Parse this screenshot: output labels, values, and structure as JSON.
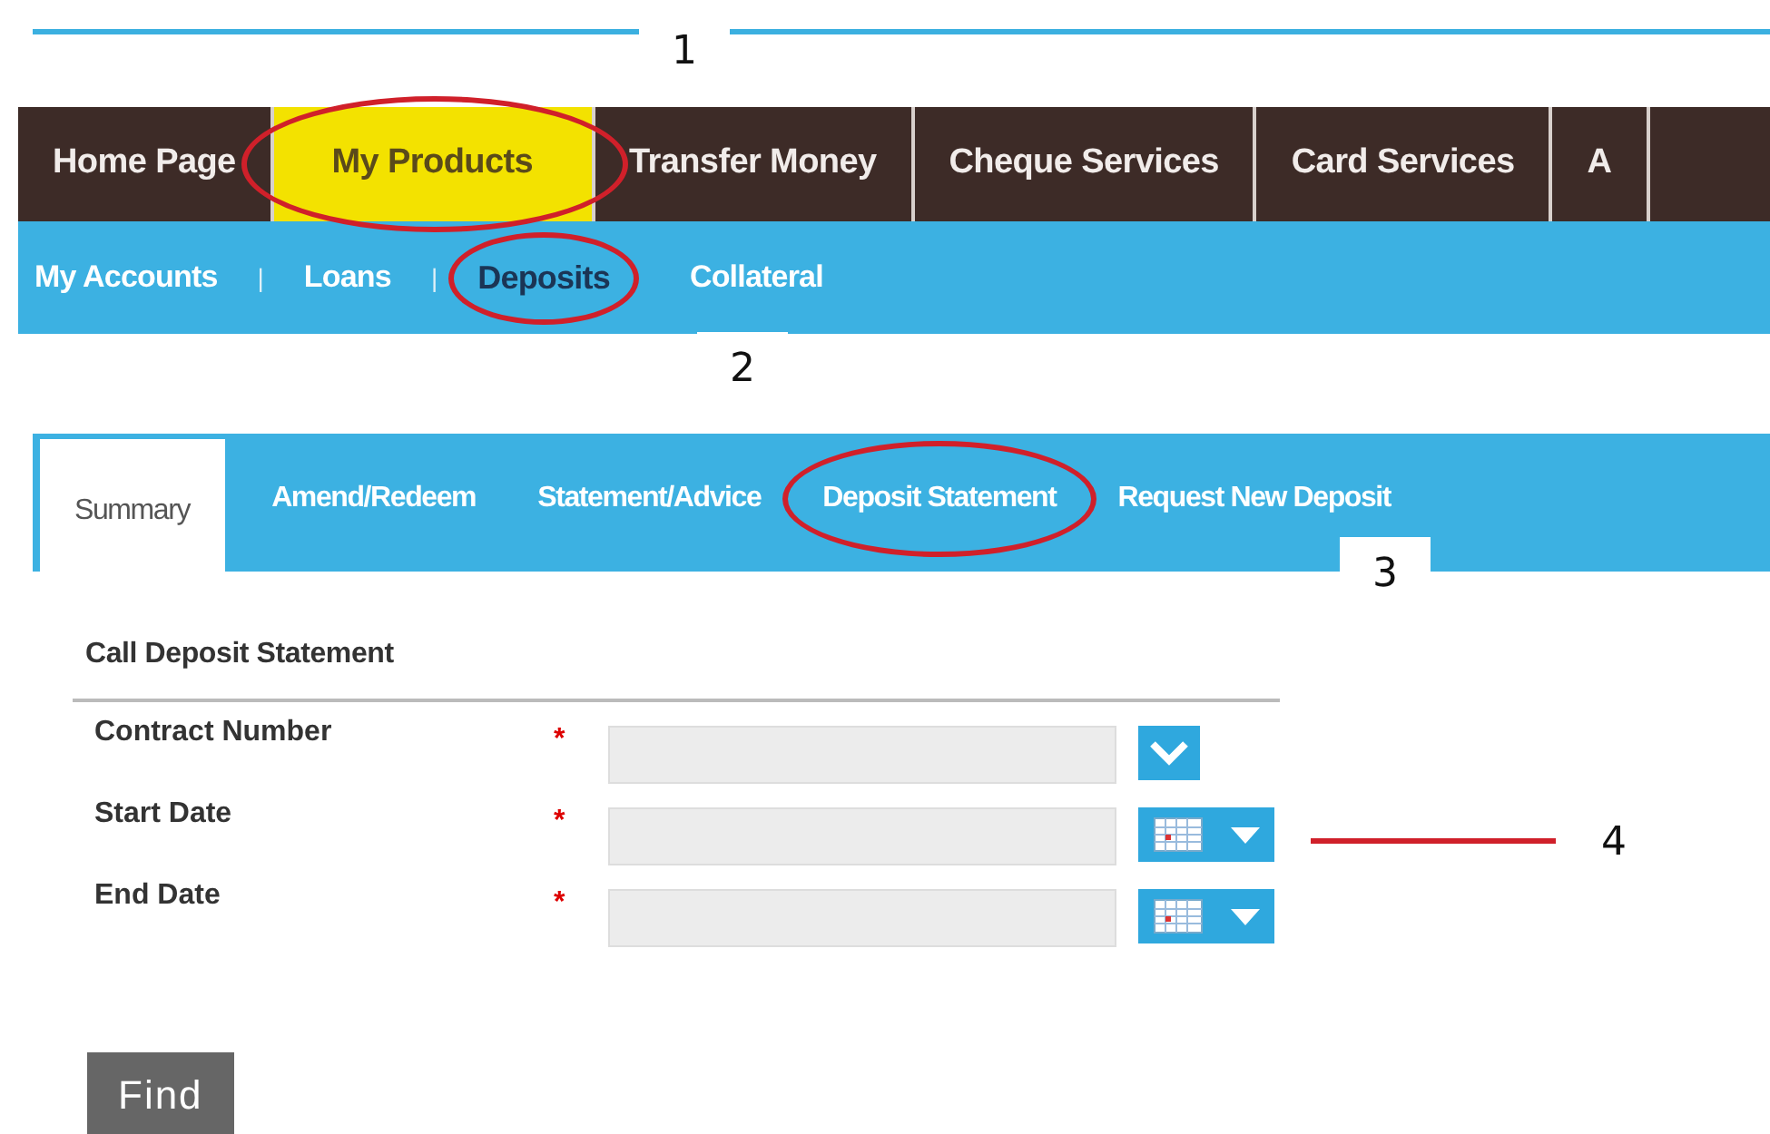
{
  "main_menu": [
    {
      "label": "Home Page",
      "selected": false,
      "circled": false
    },
    {
      "label": "My Products",
      "selected": true,
      "circled": true
    },
    {
      "label": "Transfer Money",
      "selected": false,
      "circled": false
    },
    {
      "label": "Cheque Services",
      "selected": false,
      "circled": false
    },
    {
      "label": "Card Services",
      "selected": false,
      "circled": false
    },
    {
      "label": "A",
      "selected": false,
      "circled": false
    }
  ],
  "sub_menu": [
    {
      "kind": "link",
      "label": "My Accounts",
      "selected": false,
      "circled": false
    },
    {
      "kind": "separator",
      "label": "|"
    },
    {
      "kind": "link",
      "label": "Loans",
      "selected": false,
      "circled": false
    },
    {
      "kind": "separator",
      "label": "|"
    },
    {
      "kind": "link",
      "label": "Deposits",
      "selected": true,
      "circled": true
    },
    {
      "kind": "link",
      "label": "Collateral",
      "selected": false,
      "circled": false
    }
  ],
  "tabs": [
    {
      "label": "Summary",
      "selected": true,
      "circled": false
    },
    {
      "label": "Amend/Redeem",
      "selected": false,
      "circled": false
    },
    {
      "label": "Statement/Advice",
      "selected": false,
      "circled": false
    },
    {
      "label": "Deposit Statement",
      "selected": false,
      "circled": true
    },
    {
      "label": "Request New Deposit",
      "selected": false,
      "circled": false
    }
  ],
  "form": {
    "title": "Call Deposit Statement",
    "fields": [
      {
        "label": "Contract Number",
        "required": true,
        "kind": "dropdown",
        "required_mark": "*"
      },
      {
        "label": "Start Date",
        "required": true,
        "kind": "date",
        "required_mark": "*"
      },
      {
        "label": "End Date",
        "required": true,
        "kind": "date",
        "required_mark": "*"
      }
    ],
    "button": "Find"
  },
  "annotations": [
    {
      "label": "1"
    },
    {
      "label": "2"
    },
    {
      "label": "3"
    },
    {
      "label": "4",
      "leader_line": true
    }
  ]
}
